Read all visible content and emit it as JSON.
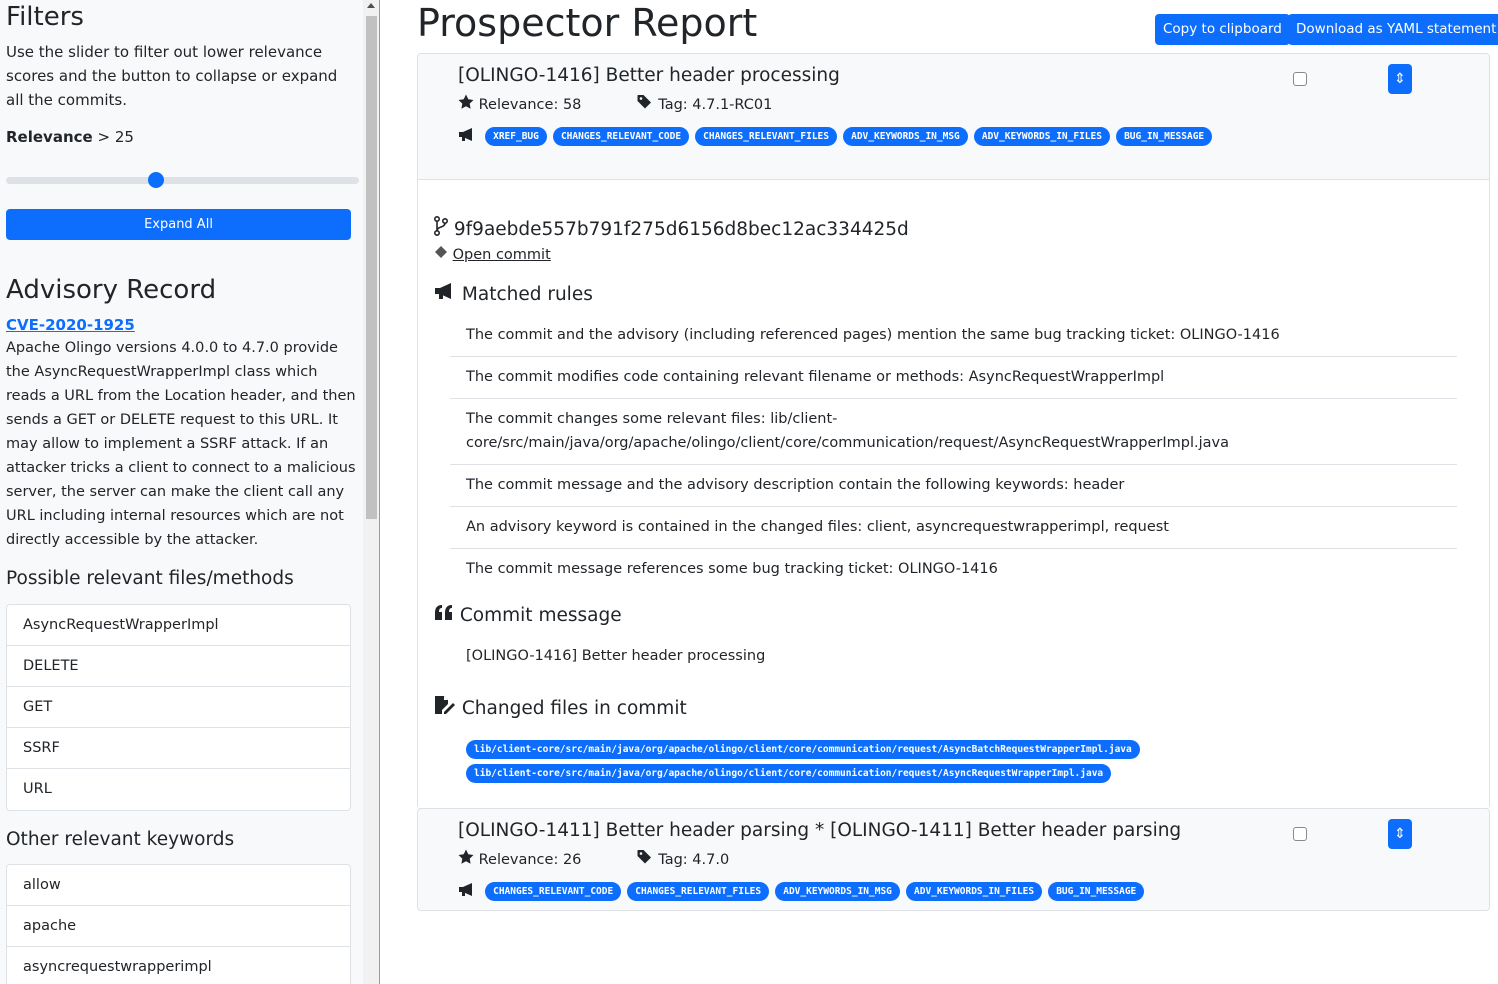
{
  "sidebar": {
    "filters_title": "Filters",
    "filters_desc": "Use the slider to filter out lower relevance scores and the button to collapse or expand all the commits.",
    "relevance_label": "Relevance",
    "relevance_op": ">",
    "relevance_value": "25",
    "slider_fraction": 0.43,
    "expand_label": "Expand All",
    "advisory_title": "Advisory Record",
    "cve_id": "CVE-2020-1925",
    "advisory_desc": "Apache Olingo versions 4.0.0 to 4.7.0 provide the AsyncRequestWrapperImpl class which reads a URL from the Location header, and then sends a GET or DELETE request to this URL. It may allow to implement a SSRF attack. If an attacker tricks a client to connect to a malicious server, the server can make the client call any URL including internal resources which are not directly accessible by the attacker.",
    "files_title": "Possible relevant files/methods",
    "files": [
      "AsyncRequestWrapperImpl",
      "DELETE",
      "GET",
      "SSRF",
      "URL"
    ],
    "keywords_title": "Other relevant keywords",
    "keywords": [
      "allow",
      "apache",
      "asyncrequestwrapperimpl"
    ]
  },
  "main": {
    "title": "Prospector Report",
    "copy_label": "Copy to clipboard",
    "download_label": "Download as YAML statement",
    "commits": [
      {
        "title": "[OLINGO-1416] Better header processing",
        "relevance_label": "Relevance: 58",
        "tag_label": "Tag: 4.7.1-RC01",
        "rules": [
          "XREF_BUG",
          "CHANGES_RELEVANT_CODE",
          "CHANGES_RELEVANT_FILES",
          "ADV_KEYWORDS_IN_MSG",
          "ADV_KEYWORDS_IN_FILES",
          "BUG_IN_MESSAGE"
        ],
        "sha": "9f9aebde557b791f275d6156d8bec12ac334425d",
        "open_commit_label": "Open commit",
        "matched_rules_title": "Matched rules",
        "matched_rules": [
          "The commit and the advisory (including referenced pages) mention the same bug tracking ticket: OLINGO-1416",
          "The commit modifies code containing relevant filename or methods: AsyncRequestWrapperImpl",
          "The commit changes some relevant files: lib/client-core/src/main/java/org/apache/olingo/client/core/communication/request/AsyncRequestWrapperImpl.java",
          "The commit message and the advisory description contain the following keywords: header",
          "An advisory keyword is contained in the changed files: client, asyncrequestwrapperimpl, request",
          "The commit message references some bug tracking ticket: OLINGO-1416"
        ],
        "commit_message_title": "Commit message",
        "commit_message": "[OLINGO-1416] Better header processing",
        "changed_files_title": "Changed files in commit",
        "changed_files": [
          "lib/client-core/src/main/java/org/apache/olingo/client/core/communication/request/AsyncBatchRequestWrapperImpl.java",
          "lib/client-core/src/main/java/org/apache/olingo/client/core/communication/request/AsyncRequestWrapperImpl.java"
        ]
      },
      {
        "title": "[OLINGO-1411] Better header parsing * [OLINGO-1411] Better header parsing",
        "relevance_label": "Relevance: 26",
        "tag_label": "Tag: 4.7.0",
        "rules": [
          "CHANGES_RELEVANT_CODE",
          "CHANGES_RELEVANT_FILES",
          "ADV_KEYWORDS_IN_MSG",
          "ADV_KEYWORDS_IN_FILES",
          "BUG_IN_MESSAGE"
        ]
      }
    ]
  },
  "colors": {
    "primary": "#0d6efd",
    "sidebar_bg": "#f8f9fa",
    "card_header_bg": "#f8f9fa"
  }
}
